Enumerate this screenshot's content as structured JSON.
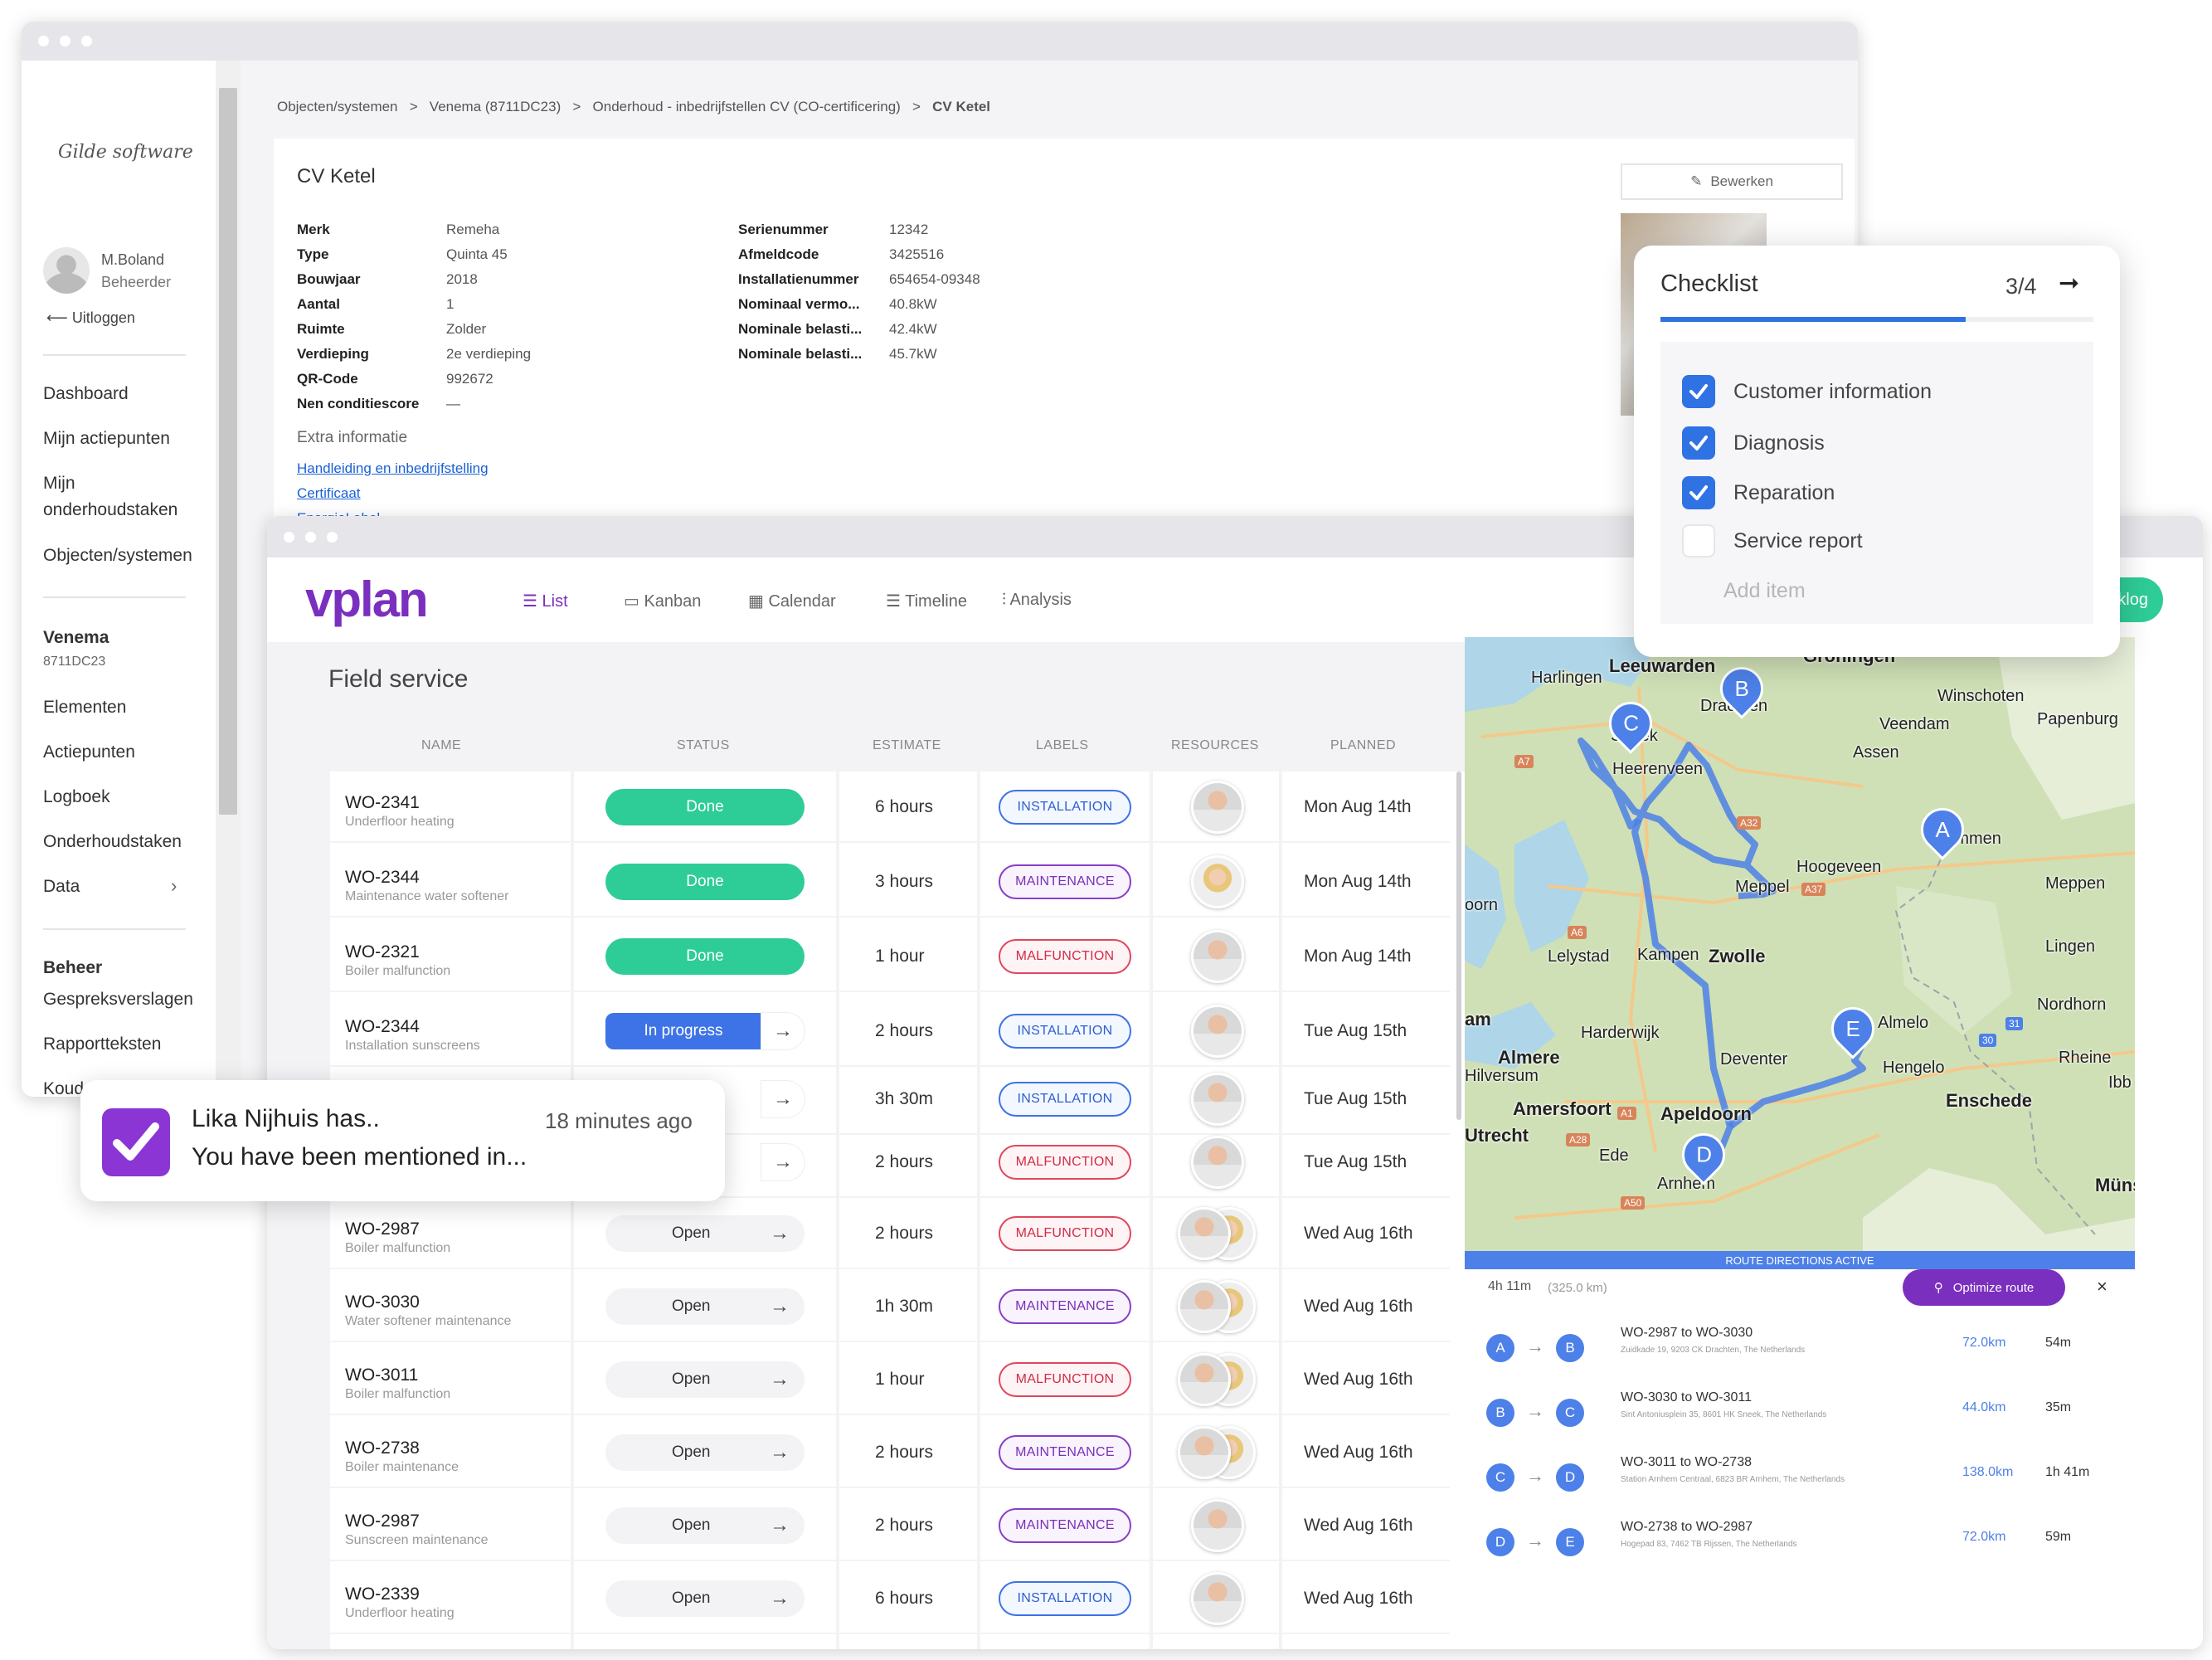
{
  "gilde": {
    "logo": "Gilde software",
    "user": {
      "name": "M.Boland",
      "role": "Beheerder"
    },
    "logout": "Uitloggen",
    "nav": [
      "Dashboard",
      "Mijn actiepunten",
      "Mijn",
      "onderhoudstaken",
      "Objecten/systemen"
    ],
    "section1": {
      "title": "Venema",
      "code": "8711DC23",
      "items": [
        "Elementen",
        "Actiepunten",
        "Logboek",
        "Onderhoudstaken",
        "Data"
      ]
    },
    "section2": {
      "title": "Beheer",
      "items": [
        "Gespreksverslagen",
        "Rapportteksten",
        "Koudemiddelen"
      ]
    },
    "breadcrumb": [
      "Objecten/systemen",
      ">",
      "Venema (8711DC23)",
      ">",
      "Onderhoud - inbedrijfstellen CV (CO-certificering)",
      ">",
      "CV Ketel"
    ],
    "title": "CV Ketel",
    "edit": "Bewerken",
    "left_props": [
      [
        "Merk",
        "Remeha"
      ],
      [
        "Type",
        "Quinta 45"
      ],
      [
        "Bouwjaar",
        "2018"
      ],
      [
        "Aantal",
        "1"
      ],
      [
        "Ruimte",
        "Zolder"
      ],
      [
        "Verdieping",
        "2e verdieping"
      ],
      [
        "QR-Code",
        "992672"
      ],
      [
        "Nen conditiescore",
        "—"
      ]
    ],
    "right_props": [
      [
        "Serienummer",
        "12342"
      ],
      [
        "Afmeldcode",
        "3425516"
      ],
      [
        "Installatienummer",
        "654654-09348"
      ],
      [
        "Nominaal vermo...",
        "40.8kW"
      ],
      [
        "Nominale belasti...",
        "42.4kW"
      ],
      [
        "Nominale belasti...",
        "45.7kW"
      ]
    ],
    "extra_title": "Extra informatie",
    "links": [
      "Handleiding en inbedrijfstelling",
      "Certificaat",
      "EnergieLabel"
    ]
  },
  "vplan": {
    "logo": "vplan",
    "tabs": [
      "List",
      "Kanban",
      "Calendar",
      "Timeline",
      "Analysis"
    ],
    "backlog": "cklog",
    "title": "Field service",
    "columns": [
      "NAME",
      "STATUS",
      "ESTIMATE",
      "LABELS",
      "RESOURCES",
      "PLANNED"
    ],
    "rows": [
      {
        "name": "WO-2341",
        "sub": "Underfloor heating",
        "status": "Done",
        "est": "6 hours",
        "label": "INSTALLATION",
        "planned": "Mon Aug 14th"
      },
      {
        "name": "WO-2344",
        "sub": "Maintenance water softener",
        "status": "Done",
        "est": "3 hours",
        "label": "MAINTENANCE",
        "planned": "Mon Aug 14th"
      },
      {
        "name": "WO-2321",
        "sub": "Boiler malfunction",
        "status": "Done",
        "est": "1 hour",
        "label": "MALFUNCTION",
        "planned": "Mon Aug 14th"
      },
      {
        "name": "WO-2344",
        "sub": "Installation sunscreens",
        "status": "In progress",
        "est": "2 hours",
        "label": "INSTALLATION",
        "planned": "Tue Aug 15th"
      },
      {
        "name": "",
        "sub": "",
        "status": "",
        "est": "3h 30m",
        "label": "INSTALLATION",
        "planned": "Tue Aug 15th"
      },
      {
        "name": "",
        "sub": "",
        "status": "",
        "est": "2 hours",
        "label": "MALFUNCTION",
        "planned": "Tue Aug 15th"
      },
      {
        "name": "WO-2987",
        "sub": "Boiler malfunction",
        "status": "Open",
        "est": "2 hours",
        "label": "MALFUNCTION",
        "planned": "Wed Aug 16th"
      },
      {
        "name": "WO-3030",
        "sub": "Water softener maintenance",
        "status": "Open",
        "est": "1h 30m",
        "label": "MAINTENANCE",
        "planned": "Wed Aug 16th"
      },
      {
        "name": "WO-3011",
        "sub": "Boiler malfunction",
        "status": "Open",
        "est": "1 hour",
        "label": "MALFUNCTION",
        "planned": "Wed Aug 16th"
      },
      {
        "name": "WO-2738",
        "sub": "Boiler maintenance",
        "status": "Open",
        "est": "2 hours",
        "label": "MAINTENANCE",
        "planned": "Wed Aug 16th"
      },
      {
        "name": "WO-2987",
        "sub": "Sunscreen maintenance",
        "status": "Open",
        "est": "2 hours",
        "label": "MAINTENANCE",
        "planned": "Wed Aug 16th"
      },
      {
        "name": "WO-2339",
        "sub": "Underfloor heating",
        "status": "Open",
        "est": "6 hours",
        "label": "INSTALLATION",
        "planned": "Wed Aug 16th"
      }
    ],
    "map": {
      "cities": [
        "Harlingen",
        "Leeuwarden",
        "Groningen",
        "Winschoten",
        "Veendam",
        "Papenburg",
        "Sneek",
        "Drachten",
        "Assen",
        "Heerenveen",
        "Emmen",
        "Hoogeveen",
        "Meppel",
        "Meppen",
        "Lelystad",
        "Kampen",
        "Zwolle",
        "Lingen",
        "Nordhorn",
        "Harderwijk",
        "Almere",
        "Hilversum",
        "Deventer",
        "Almelo",
        "Hengelo",
        "Rheine",
        "Enschede",
        "Amersfoort",
        "Apeldoorn",
        "Utrecht",
        "Ede",
        "Arnhem",
        "Münster",
        "oorn",
        "am",
        "Ibb"
      ],
      "road_labels": [
        "A7",
        "A32",
        "A37",
        "A6",
        "A28",
        "A1",
        "A50",
        "30",
        "31"
      ],
      "pins": [
        "A",
        "B",
        "C",
        "D",
        "E"
      ],
      "banner": "ROUTE DIRECTIONS ACTIVE"
    },
    "route": {
      "total_time": "4h 11m",
      "total_dist": "(325.0 km)",
      "optimize": "Optimize route",
      "close": "×",
      "legs": [
        {
          "from": "A",
          "to": "B",
          "title": "WO-2987 to WO-3030",
          "addr": "Zuidkade 19, 9203 CK Drachten, The Netherlands",
          "km": "72.0km",
          "time": "54m"
        },
        {
          "from": "B",
          "to": "C",
          "title": "WO-3030 to WO-3011",
          "addr": "Sint Antoniusplein 35, 8601 HK Sneek, The Netherlands",
          "km": "44.0km",
          "time": "35m"
        },
        {
          "from": "C",
          "to": "D",
          "title": "WO-3011 to WO-2738",
          "addr": "Station Arnhem Centraal, 6823 BR Arnhem, The Netherlands",
          "km": "138.0km",
          "time": "1h 41m"
        },
        {
          "from": "D",
          "to": "E",
          "title": "WO-2738 to WO-2987",
          "addr": "Hogepad 83, 7462 TB Rijssen, The Netherlands",
          "km": "72.0km",
          "time": "59m"
        }
      ]
    }
  },
  "checklist": {
    "title": "Checklist",
    "count": "3/4",
    "items": [
      {
        "label": "Customer information",
        "checked": true
      },
      {
        "label": "Diagnosis",
        "checked": true
      },
      {
        "label": "Reparation",
        "checked": true
      },
      {
        "label": "Service report",
        "checked": false
      }
    ],
    "add": "Add item",
    "progress": 0.75
  },
  "notification": {
    "title": "Lika Nijhuis has..",
    "time": "18 minutes ago",
    "body": "You have been mentioned in..."
  },
  "colors": {
    "accent": "#3d73e6",
    "done": "#2ecc96",
    "vplan": "#7b2fbe",
    "route": "#4d80e8"
  }
}
